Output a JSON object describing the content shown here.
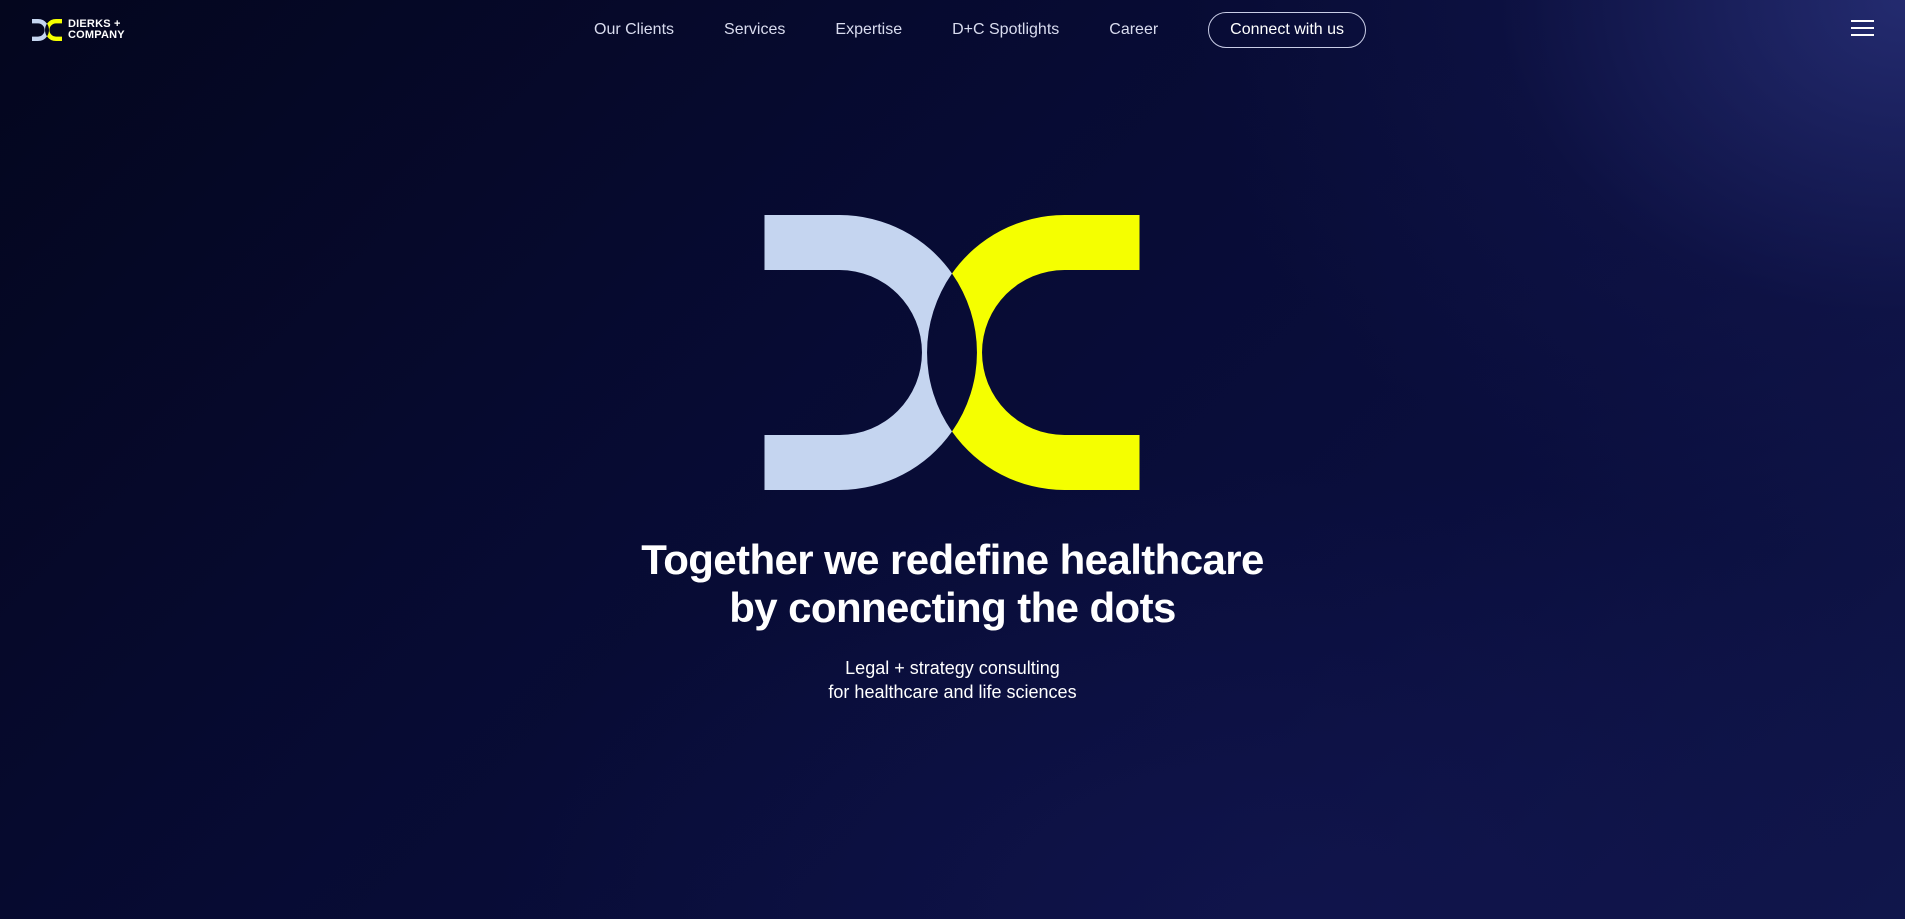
{
  "brand": {
    "name_line1": "DIERKS +",
    "name_line2": "COMPANY",
    "colors": {
      "light": "#c5d5f0",
      "accent": "#f5ff00",
      "background": "#070b33"
    }
  },
  "nav": {
    "items": [
      {
        "label": "Our Clients"
      },
      {
        "label": "Services"
      },
      {
        "label": "Expertise"
      },
      {
        "label": "D+C Spotlights"
      },
      {
        "label": "Career"
      }
    ],
    "cta_label": "Connect with us",
    "menu_icon": "hamburger-menu-icon"
  },
  "hero": {
    "headline_line1": "Together we redefine healthcare",
    "headline_line2": "by connecting the dots",
    "subline_line1": "Legal + strategy consulting",
    "subline_line2": "for healthcare and life sciences"
  }
}
